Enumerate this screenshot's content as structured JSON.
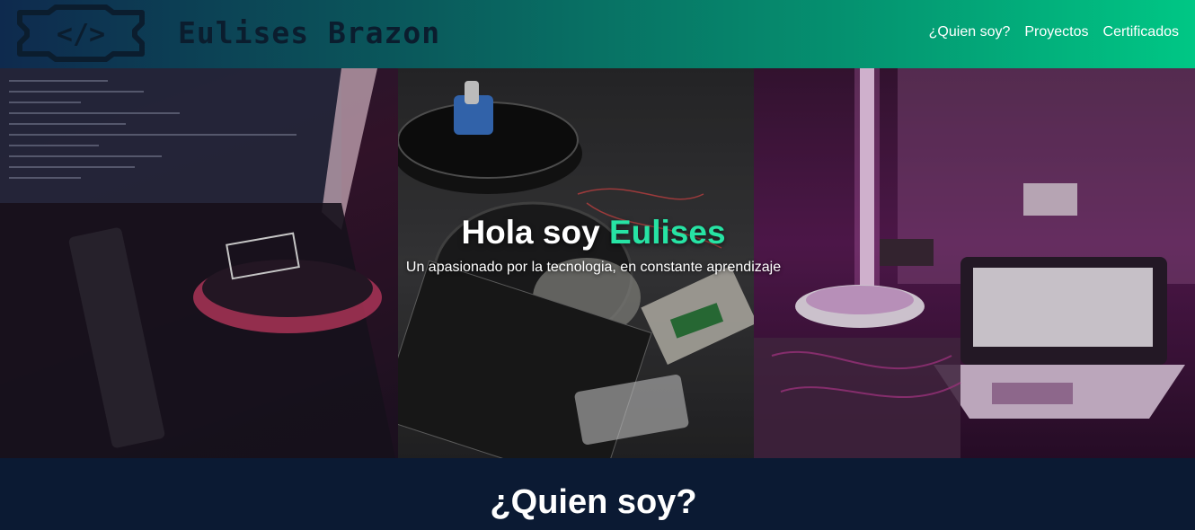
{
  "header": {
    "brand_name": "Eulises Brazon",
    "logo_glyph": "</>",
    "logo_color": "#0b1d2e",
    "nav": [
      {
        "label": "¿Quien soy?"
      },
      {
        "label": "Proyectos"
      },
      {
        "label": "Certificados"
      }
    ]
  },
  "hero": {
    "title_prefix": "Hola soy ",
    "title_highlight": "Eulises",
    "subtitle": "Un apasionado por la tecnologia, en constante aprendizaje",
    "accent_color": "#27e3a4"
  },
  "about": {
    "title": "¿Quien soy?"
  }
}
